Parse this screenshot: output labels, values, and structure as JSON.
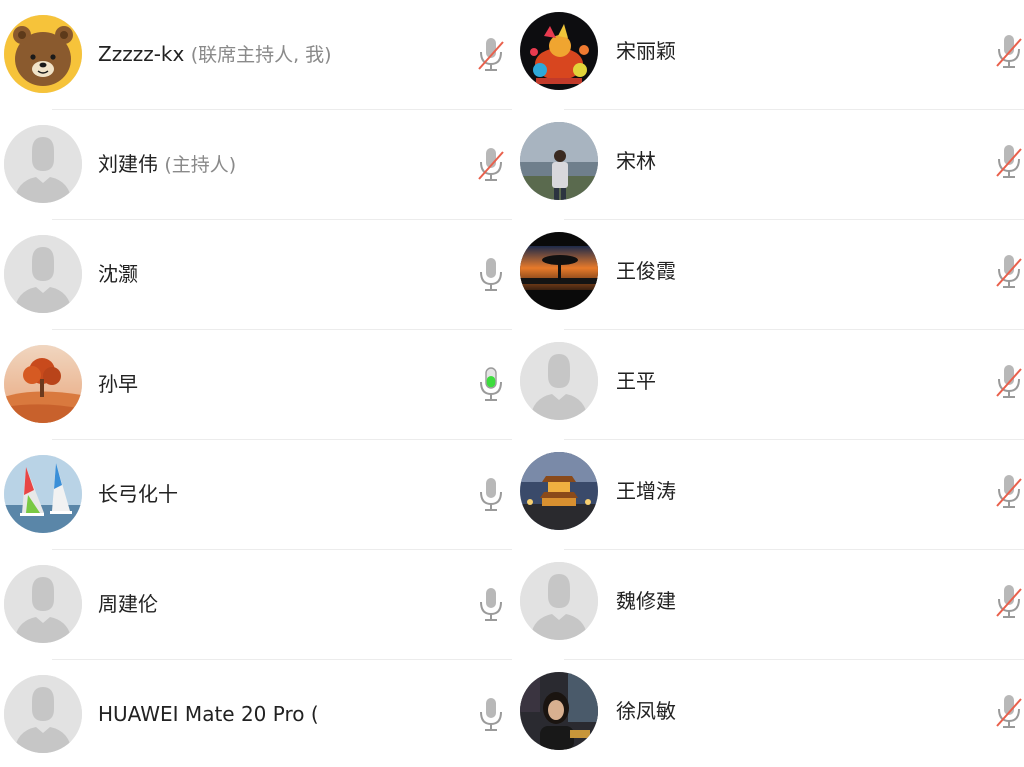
{
  "participants_left": [
    {
      "name": "Zzzzz-kx",
      "role": "(联席主持人, 我)",
      "avatar": "cartoon-bear",
      "mic": "muted"
    },
    {
      "name": "刘建伟",
      "role": "(主持人)",
      "avatar": "default-person",
      "mic": "muted"
    },
    {
      "name": "沈灏",
      "role": "",
      "avatar": "default-person",
      "mic": "on"
    },
    {
      "name": "孙早",
      "role": "",
      "avatar": "desert-tree-photo",
      "mic": "speaking"
    },
    {
      "name": "长弓化十",
      "role": "",
      "avatar": "windsurf-photo",
      "mic": "on"
    },
    {
      "name": "周建伦",
      "role": "",
      "avatar": "default-person",
      "mic": "on"
    },
    {
      "name": "HUAWEI Mate 20 Pro (",
      "role": "",
      "avatar": "default-person",
      "mic": "on"
    }
  ],
  "participants_right": [
    {
      "name": "宋丽颖",
      "role": "",
      "avatar": "lantern-rooster-photo",
      "mic": "muted"
    },
    {
      "name": "宋林",
      "role": "",
      "avatar": "man-by-lake-photo",
      "mic": "muted"
    },
    {
      "name": "王俊霞",
      "role": "",
      "avatar": "sunset-tree-photo",
      "mic": "muted"
    },
    {
      "name": "王平",
      "role": "",
      "avatar": "default-person",
      "mic": "muted"
    },
    {
      "name": "王增涛",
      "role": "",
      "avatar": "night-tower-photo",
      "mic": "muted"
    },
    {
      "name": "魏修建",
      "role": "",
      "avatar": "default-person",
      "mic": "muted"
    },
    {
      "name": "徐凤敏",
      "role": "",
      "avatar": "woman-portrait-photo",
      "mic": "muted"
    }
  ],
  "colors": {
    "mic_gray": "#9a9a9a",
    "mute_slash": "#e8604c",
    "speaking_green": "#3ddc3d",
    "default_avatar_bg": "#e2e2e2",
    "default_avatar_fg": "#c6c6c6"
  }
}
